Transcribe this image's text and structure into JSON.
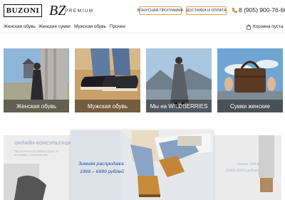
{
  "header": {
    "logo_text": "BUZONI",
    "brand_mark": "BZ",
    "brand_premium": "PREMIUM",
    "bonus_button": "БОНУСНАЯ ПРОГРАММА",
    "delivery_button": "ДОСТАВКА И ОПЛАТА",
    "phone_icon": "phone-icon",
    "phone": "8 (905) 900-76-66"
  },
  "nav": {
    "items": [
      "Женская обувь",
      "Женские сумки",
      "Мужская обувь",
      "Прочее"
    ],
    "cart_icon": "cart-icon",
    "cart_label": "Корзина пуста"
  },
  "categories": [
    {
      "label": "Женская обувь"
    },
    {
      "label": "Мужская обувь"
    },
    {
      "label": "Мы на WILDBERRIES"
    },
    {
      "label": "Сумки женские"
    }
  ],
  "banners": {
    "left_title": "ОНЛАЙН-КОНСУЛЬТАЦИЯ",
    "left_subtitle": "Персональный подбор обуви по отзывам и пожеланиям",
    "main_title_line1": "Зимняя распродажа",
    "main_title_line2": "1999 – 6999 рублей",
    "right_title_line1": "Осень SALE",
    "right_title_line2": "1999–6999 рублей"
  },
  "colors": {
    "accent_border": "#d9a25a",
    "banner_text": "#1d4f9a"
  }
}
